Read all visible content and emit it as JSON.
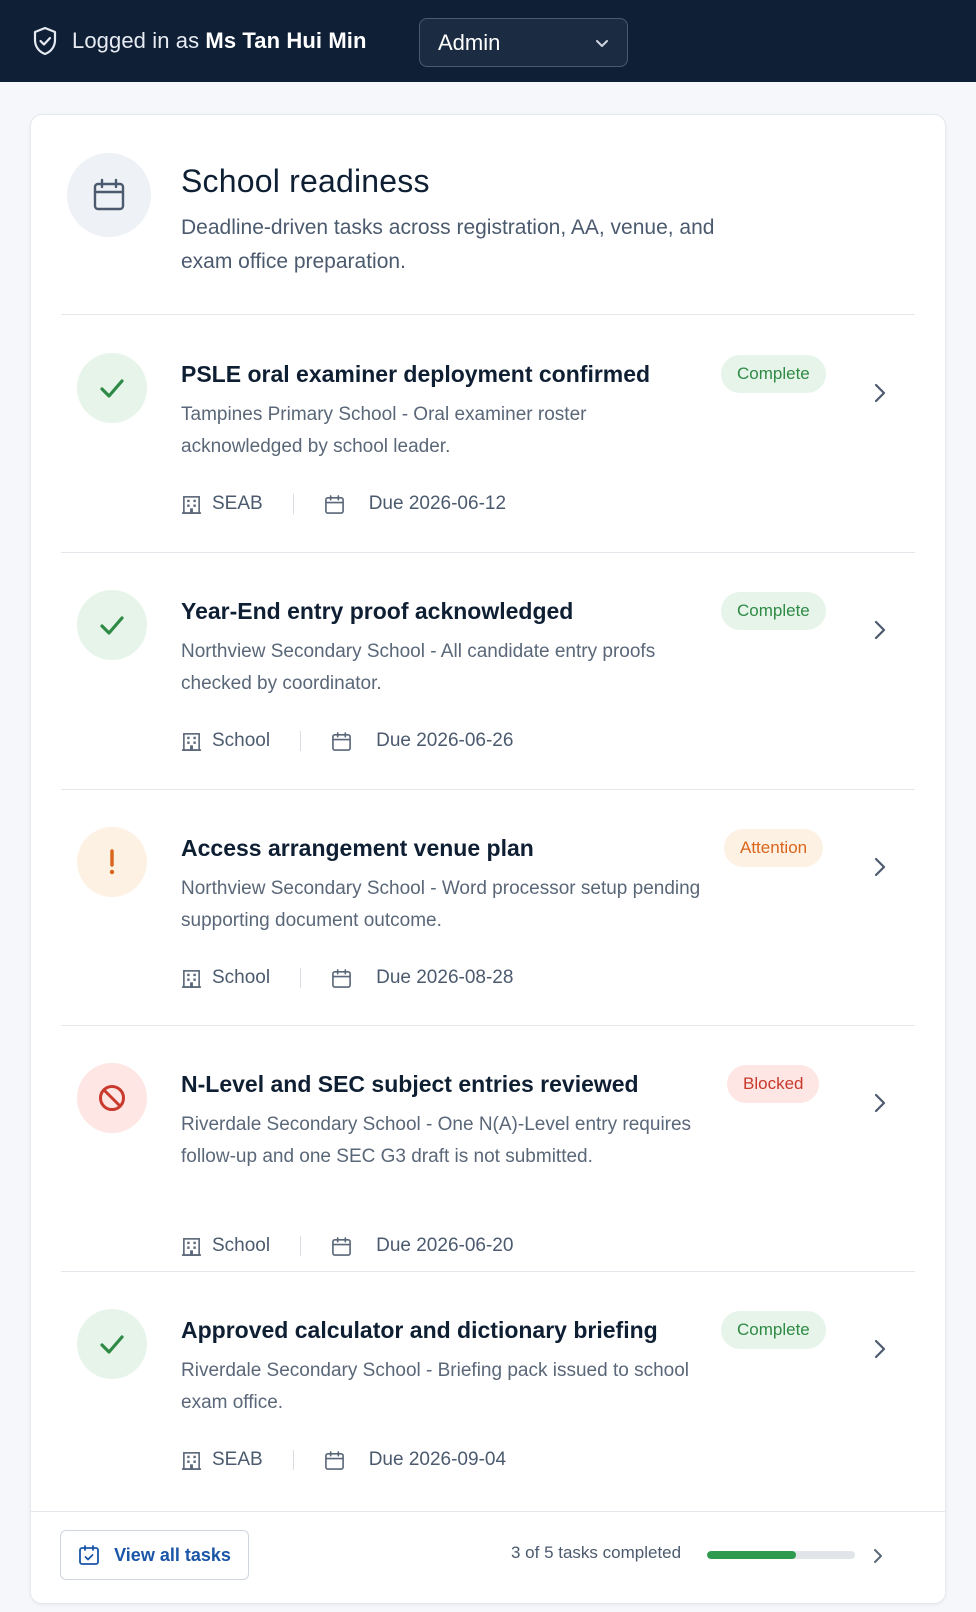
{
  "topbar": {
    "logged_in_prefix": "Logged in as ",
    "user_name": "Ms Tan Hui Min",
    "role_value": "Admin"
  },
  "card": {
    "title": "School readiness",
    "subtitle": "Deadline-driven tasks across registration, AA, venue, and exam office preparation."
  },
  "tasks": [
    {
      "title": "PSLE oral examiner deployment confirmed",
      "description": "Tampines Primary School - Oral examiner roster acknowledged by school leader.",
      "owner": "SEAB",
      "due": "Due 2026-06-12",
      "status": "Complete",
      "status_icon": "check-icon"
    },
    {
      "title": "Year-End entry proof acknowledged",
      "description": "Northview Secondary School - All candidate entry proofs checked by coordinator.",
      "owner": "School",
      "due": "Due 2026-06-26",
      "status": "Complete",
      "status_icon": "check-icon"
    },
    {
      "title": "Access arrangement venue plan",
      "description": "Northview Secondary School - Word processor setup pending supporting document outcome.",
      "owner": "School",
      "due": "Due 2026-08-28",
      "status": "Attention",
      "status_icon": "exclamation-icon"
    },
    {
      "title": "N-Level and SEC subject entries reviewed",
      "description": "Riverdale Secondary School - One N(A)-Level entry requires follow-up and one SEC G3 draft is not submitted.",
      "owner": "School",
      "due": "Due 2026-06-20",
      "status": "Blocked",
      "status_icon": "blocked-icon"
    },
    {
      "title": "Approved calculator and dictionary briefing",
      "description": "Riverdale Secondary School - Briefing pack issued to school exam office.",
      "owner": "SEAB",
      "due": "Due 2026-09-04",
      "status": "Complete",
      "status_icon": "check-icon"
    }
  ],
  "status_colors": {
    "Complete": {
      "bg": "#e6f4e9",
      "fg": "#2e8a45"
    },
    "Attention": {
      "bg": "#fdf1e4",
      "fg": "#d9651b"
    },
    "Blocked": {
      "bg": "#fde6e4",
      "fg": "#c9392c"
    }
  },
  "footer": {
    "view_all_label": "View all tasks",
    "progress_text": "3 of 5 tasks completed",
    "progress_fraction": 0.6
  }
}
